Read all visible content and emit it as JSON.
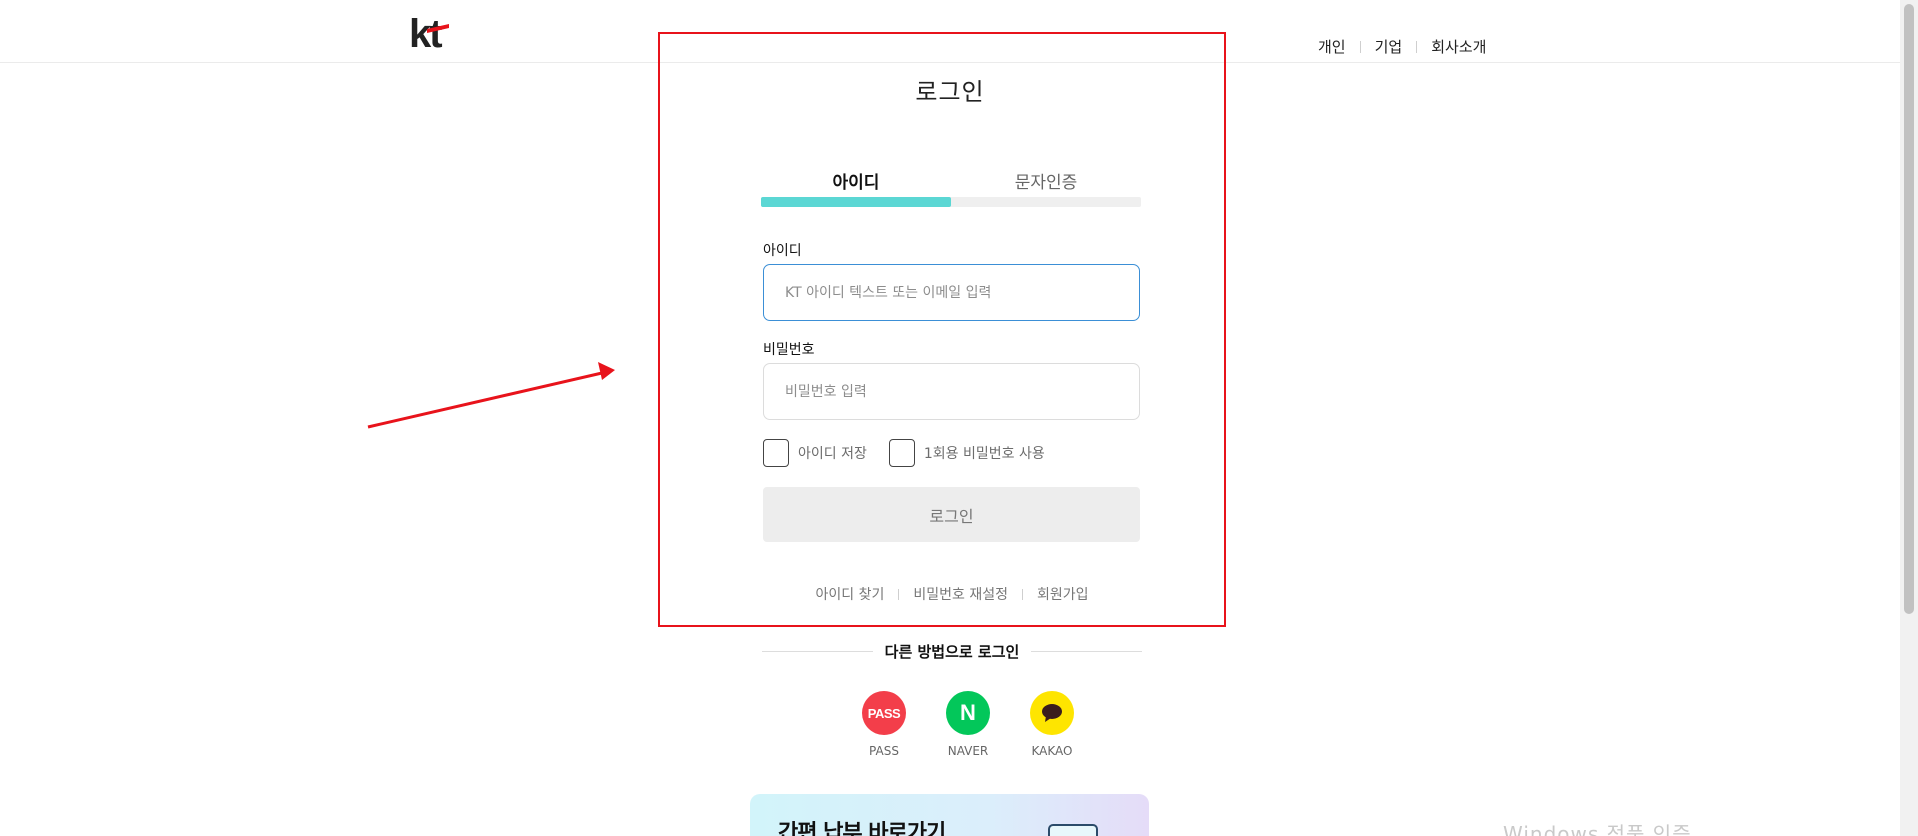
{
  "header": {
    "logo_text": "kt",
    "nav": [
      {
        "label": "개인"
      },
      {
        "label": "기업"
      },
      {
        "label": "회사소개"
      }
    ]
  },
  "login": {
    "title": "로그인",
    "tabs": [
      {
        "label": "아이디",
        "active": true
      },
      {
        "label": "문자인증",
        "active": false
      }
    ],
    "id_label": "아이디",
    "id_placeholder": "KT 아이디 텍스트 또는 이메일 입력",
    "id_value": "",
    "password_label": "비밀번호",
    "password_placeholder": "비밀번호 입력",
    "password_value": "",
    "save_id_label": "아이디 저장",
    "save_id_checked": false,
    "otp_label": "1회용 비밀번호 사용",
    "otp_checked": false,
    "submit_label": "로그인",
    "links": [
      {
        "label": "아이디 찾기"
      },
      {
        "label": "비밀번호 재설정"
      },
      {
        "label": "회원가입"
      }
    ]
  },
  "other_login": {
    "heading": "다른 방법으로 로그인",
    "providers": [
      {
        "label": "PASS",
        "icon": "pass-icon",
        "icon_text": "PASS",
        "color": "#f33e4a"
      },
      {
        "label": "NAVER",
        "icon": "naver-icon",
        "icon_text": "N",
        "color": "#03c75a"
      },
      {
        "label": "KAKAO",
        "icon": "kakao-icon",
        "color": "#fee500"
      }
    ]
  },
  "banner": {
    "title": "간편 납부 바로가기"
  },
  "watermark": {
    "text": "Windows 정품 인증"
  },
  "colors": {
    "tab_active": "#5bd7d4",
    "annotation": "#e8131b",
    "focus_border": "#3b8fd6",
    "kt_red": "#e8131b"
  }
}
